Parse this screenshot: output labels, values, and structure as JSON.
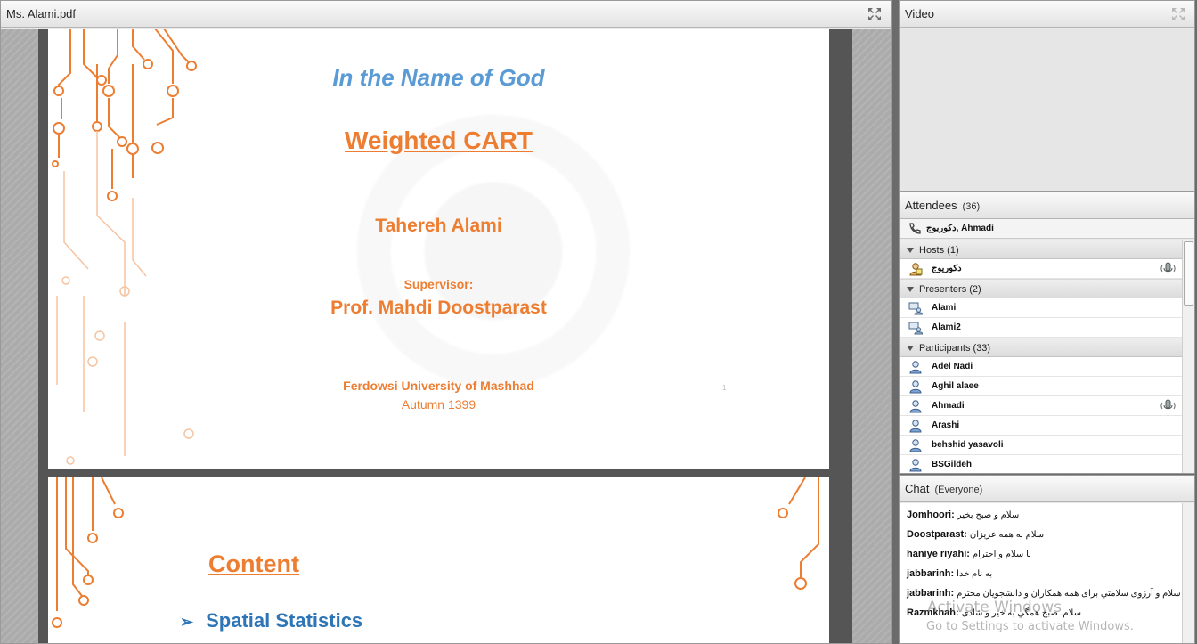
{
  "share_pod": {
    "title": "Ms. Alami.pdf"
  },
  "slide1": {
    "title_god": "In the Name of God",
    "title_main": "Weighted CART",
    "author": "Tahereh Alami",
    "supervisor_label": "Supervisor:",
    "supervisor": "Prof. Mahdi Doostparast",
    "university": "Ferdowsi University of Mashhad",
    "term": "Autumn 1399",
    "page_number": "1"
  },
  "slide2": {
    "heading": "Content",
    "bullet_marker": "➢",
    "bullet": "Spatial Statistics"
  },
  "video_pod": {
    "title": "Video"
  },
  "attendees_pod": {
    "title": "Attendees",
    "count": "(36)",
    "status_line": "دكوريوج, Ahmadi",
    "groups": [
      {
        "label": "Hosts (1)",
        "members": [
          {
            "name": "دكوريوج",
            "icon": "host-icon",
            "mic": true
          }
        ]
      },
      {
        "label": "Presenters (2)",
        "members": [
          {
            "name": "Alami",
            "icon": "presenter-icon",
            "mic": false
          },
          {
            "name": "Alami2",
            "icon": "presenter-icon",
            "mic": false
          }
        ]
      },
      {
        "label": "Participants (33)",
        "members": [
          {
            "name": "Adel Nadi",
            "icon": "participant-icon",
            "mic": false
          },
          {
            "name": "Aghil alaee",
            "icon": "participant-icon",
            "mic": false
          },
          {
            "name": "Ahmadi",
            "icon": "participant-icon",
            "mic": true
          },
          {
            "name": "Arashi",
            "icon": "participant-icon",
            "mic": false
          },
          {
            "name": "behshid yasavoli",
            "icon": "participant-icon",
            "mic": false
          },
          {
            "name": "BSGildeh",
            "icon": "participant-icon",
            "mic": false
          }
        ]
      }
    ]
  },
  "chat_pod": {
    "title": "Chat",
    "scope": "(Everyone)",
    "messages": [
      {
        "sender": "Jomhoori:",
        "text": "سلام و صبح بخير"
      },
      {
        "sender": "Doostparast:",
        "text": "سلام به همه عزيزان"
      },
      {
        "sender": "haniye riyahi:",
        "text": "با سلام و احترام"
      },
      {
        "sender": "jabbarinh:",
        "text": "به نام خدا"
      },
      {
        "sender": "jabbarinh:",
        "text": "با سلام و آرزوی سلامتي برای همه همکاران و دانشجويان محترم"
      },
      {
        "sender": "Razmkhah:",
        "text": "سلام. صبح همگي به خير و شادی"
      }
    ]
  },
  "os_watermark": {
    "line1": "Activate Windows",
    "line2": "Go to Settings to activate Windows."
  },
  "colors": {
    "accent_orange": "#ed7d31",
    "accent_blue": "#5b9bd5",
    "bullet_blue": "#2e75b6"
  }
}
